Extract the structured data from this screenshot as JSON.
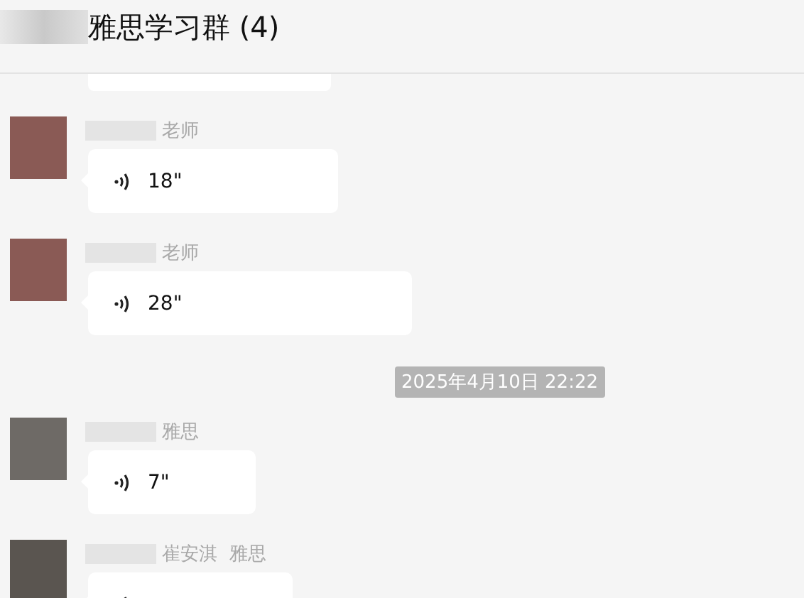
{
  "header": {
    "title": "雅思学习群 (4)"
  },
  "items": [
    {
      "kind": "partial"
    },
    {
      "kind": "voice",
      "sender": "老师",
      "duration": "18\""
    },
    {
      "kind": "voice",
      "sender": "老师",
      "duration": "28\""
    },
    {
      "kind": "time",
      "text": "2025年4月10日 22:22"
    },
    {
      "kind": "voice",
      "sender": "雅思",
      "duration": "7\""
    },
    {
      "kind": "voice",
      "sender": "崔安淇  雅思"
    }
  ]
}
